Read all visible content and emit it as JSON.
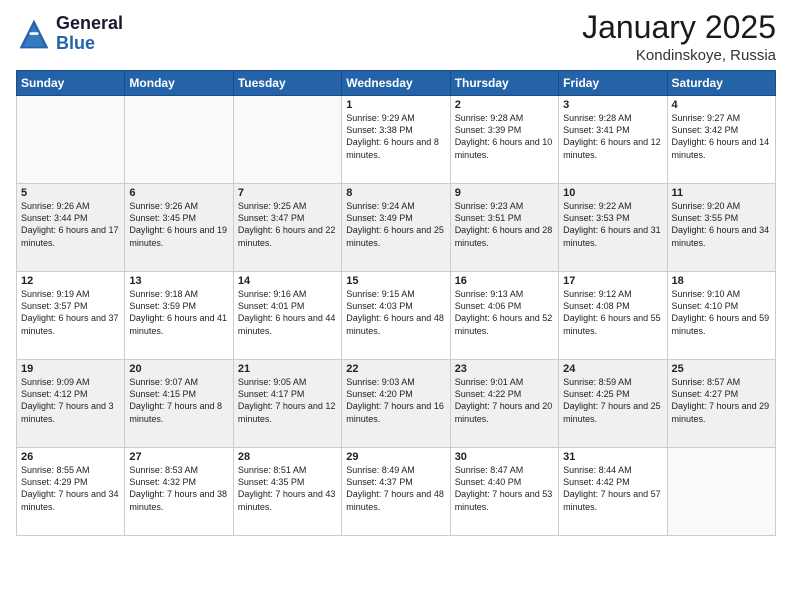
{
  "logo": {
    "general": "General",
    "blue": "Blue"
  },
  "title": "January 2025",
  "location": "Kondinskoye, Russia",
  "days_header": [
    "Sunday",
    "Monday",
    "Tuesday",
    "Wednesday",
    "Thursday",
    "Friday",
    "Saturday"
  ],
  "weeks": [
    [
      {
        "day": "",
        "info": ""
      },
      {
        "day": "",
        "info": ""
      },
      {
        "day": "",
        "info": ""
      },
      {
        "day": "1",
        "info": "Sunrise: 9:29 AM\nSunset: 3:38 PM\nDaylight: 6 hours and 8 minutes."
      },
      {
        "day": "2",
        "info": "Sunrise: 9:28 AM\nSunset: 3:39 PM\nDaylight: 6 hours and 10 minutes."
      },
      {
        "day": "3",
        "info": "Sunrise: 9:28 AM\nSunset: 3:41 PM\nDaylight: 6 hours and 12 minutes."
      },
      {
        "day": "4",
        "info": "Sunrise: 9:27 AM\nSunset: 3:42 PM\nDaylight: 6 hours and 14 minutes."
      }
    ],
    [
      {
        "day": "5",
        "info": "Sunrise: 9:26 AM\nSunset: 3:44 PM\nDaylight: 6 hours and 17 minutes."
      },
      {
        "day": "6",
        "info": "Sunrise: 9:26 AM\nSunset: 3:45 PM\nDaylight: 6 hours and 19 minutes."
      },
      {
        "day": "7",
        "info": "Sunrise: 9:25 AM\nSunset: 3:47 PM\nDaylight: 6 hours and 22 minutes."
      },
      {
        "day": "8",
        "info": "Sunrise: 9:24 AM\nSunset: 3:49 PM\nDaylight: 6 hours and 25 minutes."
      },
      {
        "day": "9",
        "info": "Sunrise: 9:23 AM\nSunset: 3:51 PM\nDaylight: 6 hours and 28 minutes."
      },
      {
        "day": "10",
        "info": "Sunrise: 9:22 AM\nSunset: 3:53 PM\nDaylight: 6 hours and 31 minutes."
      },
      {
        "day": "11",
        "info": "Sunrise: 9:20 AM\nSunset: 3:55 PM\nDaylight: 6 hours and 34 minutes."
      }
    ],
    [
      {
        "day": "12",
        "info": "Sunrise: 9:19 AM\nSunset: 3:57 PM\nDaylight: 6 hours and 37 minutes."
      },
      {
        "day": "13",
        "info": "Sunrise: 9:18 AM\nSunset: 3:59 PM\nDaylight: 6 hours and 41 minutes."
      },
      {
        "day": "14",
        "info": "Sunrise: 9:16 AM\nSunset: 4:01 PM\nDaylight: 6 hours and 44 minutes."
      },
      {
        "day": "15",
        "info": "Sunrise: 9:15 AM\nSunset: 4:03 PM\nDaylight: 6 hours and 48 minutes."
      },
      {
        "day": "16",
        "info": "Sunrise: 9:13 AM\nSunset: 4:06 PM\nDaylight: 6 hours and 52 minutes."
      },
      {
        "day": "17",
        "info": "Sunrise: 9:12 AM\nSunset: 4:08 PM\nDaylight: 6 hours and 55 minutes."
      },
      {
        "day": "18",
        "info": "Sunrise: 9:10 AM\nSunset: 4:10 PM\nDaylight: 6 hours and 59 minutes."
      }
    ],
    [
      {
        "day": "19",
        "info": "Sunrise: 9:09 AM\nSunset: 4:12 PM\nDaylight: 7 hours and 3 minutes."
      },
      {
        "day": "20",
        "info": "Sunrise: 9:07 AM\nSunset: 4:15 PM\nDaylight: 7 hours and 8 minutes."
      },
      {
        "day": "21",
        "info": "Sunrise: 9:05 AM\nSunset: 4:17 PM\nDaylight: 7 hours and 12 minutes."
      },
      {
        "day": "22",
        "info": "Sunrise: 9:03 AM\nSunset: 4:20 PM\nDaylight: 7 hours and 16 minutes."
      },
      {
        "day": "23",
        "info": "Sunrise: 9:01 AM\nSunset: 4:22 PM\nDaylight: 7 hours and 20 minutes."
      },
      {
        "day": "24",
        "info": "Sunrise: 8:59 AM\nSunset: 4:25 PM\nDaylight: 7 hours and 25 minutes."
      },
      {
        "day": "25",
        "info": "Sunrise: 8:57 AM\nSunset: 4:27 PM\nDaylight: 7 hours and 29 minutes."
      }
    ],
    [
      {
        "day": "26",
        "info": "Sunrise: 8:55 AM\nSunset: 4:29 PM\nDaylight: 7 hours and 34 minutes."
      },
      {
        "day": "27",
        "info": "Sunrise: 8:53 AM\nSunset: 4:32 PM\nDaylight: 7 hours and 38 minutes."
      },
      {
        "day": "28",
        "info": "Sunrise: 8:51 AM\nSunset: 4:35 PM\nDaylight: 7 hours and 43 minutes."
      },
      {
        "day": "29",
        "info": "Sunrise: 8:49 AM\nSunset: 4:37 PM\nDaylight: 7 hours and 48 minutes."
      },
      {
        "day": "30",
        "info": "Sunrise: 8:47 AM\nSunset: 4:40 PM\nDaylight: 7 hours and 53 minutes."
      },
      {
        "day": "31",
        "info": "Sunrise: 8:44 AM\nSunset: 4:42 PM\nDaylight: 7 hours and 57 minutes."
      },
      {
        "day": "",
        "info": ""
      }
    ]
  ]
}
